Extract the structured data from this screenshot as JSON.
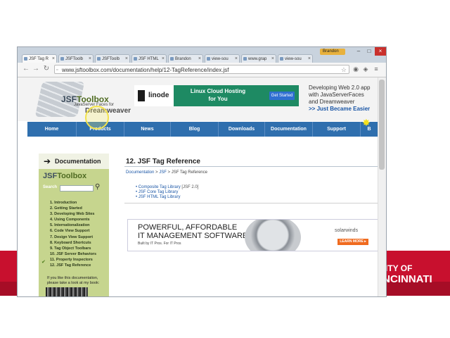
{
  "browser": {
    "tabs": [
      {
        "label": "JSF Tag R",
        "active": true
      },
      {
        "label": "JSFToolb"
      },
      {
        "label": "JSFToolb"
      },
      {
        "label": "JSF HTML"
      },
      {
        "label": "Brandon"
      },
      {
        "label": "view-sou"
      },
      {
        "label": "www.grap"
      },
      {
        "label": "view-sou"
      }
    ],
    "user": "Brandon",
    "url": "www.jsftoolbox.com/documentation/help/12-TagReference/index.jsf",
    "tab_close": "×",
    "win_min": "–",
    "win_max": "□",
    "win_close": "×"
  },
  "site": {
    "logo_prefix": "JSF",
    "logo_suffix": "Toolbox",
    "logo_sub": "JavaServer Faces for",
    "logo_dw": "Dreamweaver",
    "ad": {
      "brand": "linode",
      "text_line1": "Linux Cloud Hosting",
      "text_line2": "for You",
      "button": "Get Started"
    },
    "promo": {
      "line1": "Developing Web 2.0 app",
      "line2": "with JavaServerFaces",
      "line3": "and Dreamweaver",
      "line4": ">> Just Became Easier"
    },
    "nav": [
      "Home",
      "Products",
      "News",
      "Blog",
      "Downloads",
      "Documentation",
      "Support",
      "B"
    ]
  },
  "sidebar": {
    "heading": "Documentation",
    "logo_prefix": "JSF",
    "logo_suffix": "Toolbox",
    "search_label": "Search",
    "items": [
      "1. Introduction",
      "2. Getting Started",
      "3. Developing Web Sites",
      "4. Using Components",
      "5. Internationalization",
      "6. Code View Support",
      "7. Design View Support",
      "8. Keyboard Shortcuts",
      "9. Tag Object Toolbars",
      "10. JSF Server Behaviors",
      "11. Property Inspectors",
      "12. JSF Tag Reference"
    ],
    "note_line1": "If you like this documentation,",
    "note_line2": "please take a look at my book:"
  },
  "content": {
    "title": "12. JSF Tag Reference",
    "breadcrumb": {
      "a1": "Documentation",
      "sep": " > ",
      "a2": "JSF",
      "current": "JSF Tag Reference"
    },
    "links": [
      {
        "text": "Composite Tag Library",
        "suffix": " [JSF 2.0]"
      },
      {
        "text": "JSF Core Tag Library"
      },
      {
        "text": "JSF HTML Tag Library"
      }
    ]
  },
  "bottom_ad": {
    "line1": "POWERFUL, AFFORDABLE",
    "line2": "IT MANAGEMENT SOFTWARE",
    "line3": "Built by IT Pros. For IT Pros",
    "brand": "solarwinds",
    "button": "LEARN MORE ▸"
  },
  "backdrop": {
    "uc_line1": "SITY OF",
    "uc_line2": "INCINNATI"
  }
}
